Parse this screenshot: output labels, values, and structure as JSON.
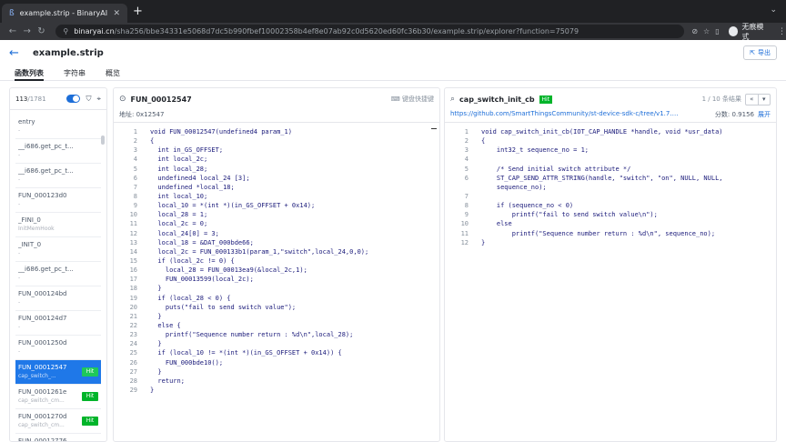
{
  "browser": {
    "tab_title": "example.strip - BinaryAI",
    "url_domain": "binaryai.cn",
    "url_path": "/sha256/bbe34331e5068d7dc5b990fbef10002358b4ef8e07ab92c0d5620ed60fc36b30/example.strip/explorer?function=75079",
    "profile_label": "无痕模式"
  },
  "header": {
    "title": "example.strip",
    "export_label": "导出"
  },
  "main_tabs": [
    "函数列表",
    "字符串",
    "概览"
  ],
  "sidebar": {
    "count": "113",
    "total": "/1781",
    "items": [
      {
        "name": "entry",
        "sub": "-",
        "hit": ""
      },
      {
        "name": "__i686.get_pc_t...",
        "sub": "-",
        "hit": ""
      },
      {
        "name": "__i686.get_pc_t...",
        "sub": "-",
        "hit": ""
      },
      {
        "name": "FUN_000123d0",
        "sub": "-",
        "hit": ""
      },
      {
        "name": "_FINI_0",
        "sub": "InitMemHook",
        "hit": ""
      },
      {
        "name": "_INIT_0",
        "sub": "-",
        "hit": ""
      },
      {
        "name": "__i686.get_pc_t...",
        "sub": "-",
        "hit": ""
      },
      {
        "name": "FUN_000124bd",
        "sub": "-",
        "hit": ""
      },
      {
        "name": "FUN_000124d7",
        "sub": "-",
        "hit": ""
      },
      {
        "name": "FUN_0001250d",
        "sub": "-",
        "hit": ""
      },
      {
        "name": "FUN_00012547",
        "sub": "cap_switch_...",
        "hit": "Hit",
        "selected": true
      },
      {
        "name": "FUN_0001261e",
        "sub": "cap_switch_cm...",
        "hit": "Hit"
      },
      {
        "name": "FUN_0001270d",
        "sub": "cap_switch_cm...",
        "hit": "Hit"
      },
      {
        "name": "FUN_00012776",
        "sub": "",
        "hit": ""
      }
    ]
  },
  "decompiled": {
    "function_name": "FUN_00012547",
    "shortcut_label": "键盘快捷键",
    "address_label": "地址: 0x12547",
    "lines": [
      "void FUN_00012547(undefined4 param_1)",
      "{",
      "  int in_GS_OFFSET;",
      "  int local_2c;",
      "  int local_28;",
      "  undefined4 local_24 [3];",
      "  undefined *local_18;",
      "  int local_10;",
      "  local_10 = *(int *)(in_GS_OFFSET + 0x14);",
      "  local_28 = 1;",
      "  local_2c = 0;",
      "  local_24[0] = 3;",
      "  local_18 = &DAT_000bde66;",
      "  local_2c = FUN_000133b1(param_1,\"switch\",local_24,0,0);",
      "  if (local_2c != 0) {",
      "    local_28 = FUN_00013ea9(&local_2c,1);",
      "    FUN_00013599(local_2c);",
      "  }",
      "  if (local_28 < 0) {",
      "    puts(\"fail to send switch value\");",
      "  }",
      "  else {",
      "    printf(\"Sequence number return : %d\\n\",local_28);",
      "  }",
      "  if (local_10 != *(int *)(in_GS_OFFSET + 0x14)) {",
      "    FUN_000bde10();",
      "  }",
      "  return;",
      "}"
    ]
  },
  "match": {
    "function_name": "cap_switch_init_cb",
    "hit_label": "Hit",
    "page_info": "1 / 10 条结果",
    "url": "https://github.com/SmartThingsCommunity/st-device-sdk-c/tree/v1.7.0/examp...",
    "score": "分数: 0.9156",
    "expand_label": "展开",
    "lines": [
      "void cap_switch_init_cb(IOT_CAP_HANDLE *handle, void *usr_data)",
      "{",
      "    int32_t sequence_no = 1;",
      "",
      "    /* Send initial switch attribute */",
      "    ST_CAP_SEND_ATTR_STRING(handle, \"switch\", \"on\", NULL, NULL,",
      "    sequence_no);",
      "",
      "    if (sequence_no < 0)",
      "        printf(\"fail to send switch value\\n\");",
      "    else",
      "        printf(\"Sequence number return : %d\\n\", sequence_no);",
      "}"
    ],
    "line_numbers": [
      "1",
      "2",
      "3",
      "4",
      "5",
      "6",
      "",
      "7",
      "8",
      "9",
      "10",
      "11",
      "12"
    ]
  }
}
